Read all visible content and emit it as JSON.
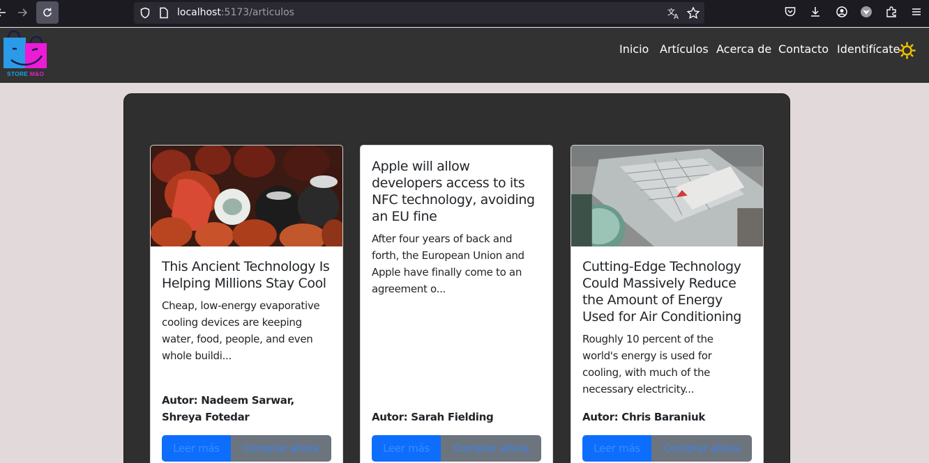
{
  "browser": {
    "url_host": "localhost",
    "url_path": ":5173/articulos"
  },
  "site": {
    "logo_text_store": "STORE ",
    "logo_text_mo": "M&O",
    "nav": [
      "Inicio",
      "Artículos",
      "Acerca de",
      "Contacto",
      "Identifícate"
    ]
  },
  "articles": [
    {
      "title": "This Ancient Technology Is Helping Millions Stay Cool",
      "summary": "Cheap, low-energy evaporative cooling devices are keeping water, food, people, and even whole buildi...",
      "author": "Autor: Nadeem Sarwar, Shreya Fotedar",
      "read_label": "Leer más",
      "buy_label": "Comprar ahora",
      "image": "clay-pots-photo"
    },
    {
      "title": "Apple will allow developers access to its NFC technology, avoiding an EU fine",
      "summary": "After four years of back and forth, the European Union and Apple have finally come to an agreement o...",
      "author": "Autor: Sarah Fielding",
      "read_label": "Leer más",
      "buy_label": "Comprar ahora",
      "image": null
    },
    {
      "title": "Cutting-Edge Technology Could Massively Reduce the Amount of Energy Used for Air Conditioning",
      "summary": "Roughly 10 percent of the world's energy is used for cooling, with much of the necessary electricity...",
      "author": "Autor: Chris Baraniuk",
      "read_label": "Leer más",
      "buy_label": "Comprar ahora",
      "image": "rooftop-aerial-photo"
    }
  ],
  "colors": {
    "page_bg": "#e2d9da",
    "header_bg": "#323232",
    "panel_bg": "#2f2f2f",
    "primary": "#0d6efd",
    "secondary": "#6c757d",
    "sun": "#f5c400"
  }
}
